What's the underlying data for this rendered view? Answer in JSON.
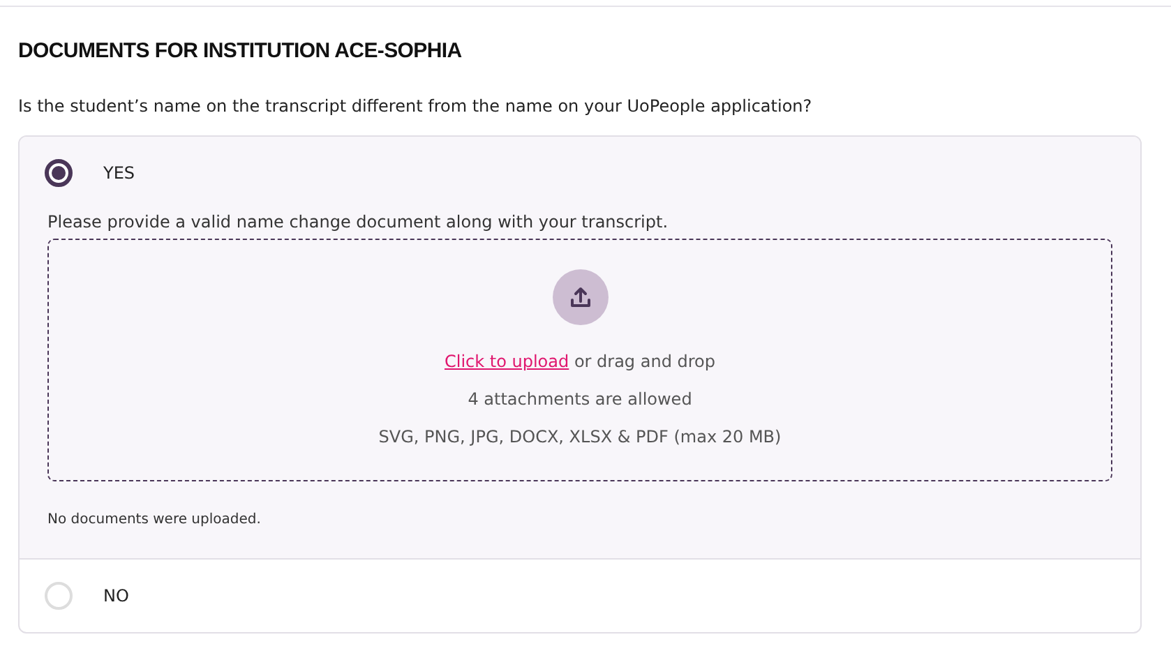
{
  "section": {
    "title": "DOCUMENTS FOR INSTITUTION ACE-SOPHIA"
  },
  "question": "Is the student’s name on the transcript different from the name on your UoPeople application?",
  "options": [
    {
      "label": "YES",
      "selected": true,
      "instruction": "Please provide a valid name change document along with your transcript.",
      "upload": {
        "link": "Click to upload",
        "rest": " or drag and drop",
        "limit": "4 attachments are allowed",
        "formats": "SVG, PNG, JPG, DOCX, XLSX & PDF (max 20 MB)"
      },
      "status": "No documents were uploaded."
    },
    {
      "label": "NO",
      "selected": false
    }
  ]
}
